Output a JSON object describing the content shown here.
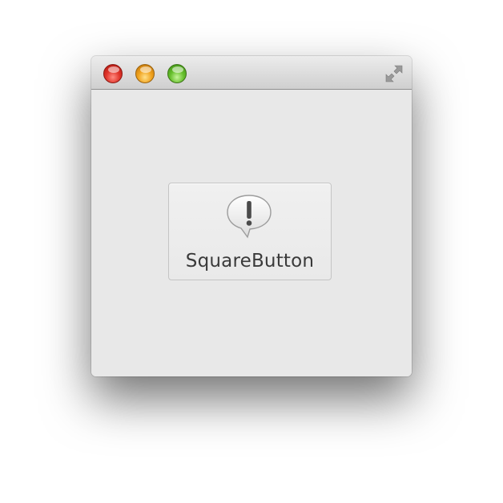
{
  "window": {
    "controls": {
      "close_icon": "close-icon",
      "minimize_icon": "minimize-icon",
      "zoom_icon": "zoom-icon",
      "fullscreen_icon": "fullscreen-icon"
    },
    "colors": {
      "close": "#e0352b",
      "minimize": "#f0a21d",
      "zoom": "#66bf2c",
      "background": "#e8e8e8"
    }
  },
  "square_button": {
    "label": "SquareButton",
    "icon": "exclamation-speech-bubble-icon"
  }
}
